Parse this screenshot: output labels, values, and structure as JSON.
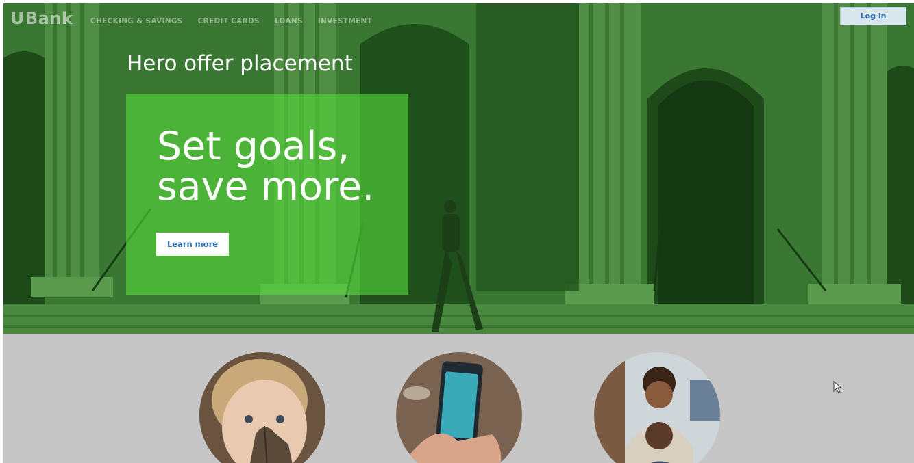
{
  "brand": {
    "logo_text": "Bank",
    "logo_mark": "U"
  },
  "nav": {
    "items": [
      {
        "label": "CHECKING & SAVINGS"
      },
      {
        "label": "CREDIT CARDS"
      },
      {
        "label": "LOANS"
      },
      {
        "label": "INVESTMENT"
      }
    ]
  },
  "header": {
    "login_label": "Log in"
  },
  "hero": {
    "placement_label": "Hero offer placement",
    "offer_title_line1": "Set goals,",
    "offer_title_line2": "save more.",
    "cta_label": "Learn more"
  },
  "colors": {
    "hero_overlay": "#2f6e28",
    "offer_box": "#56d93c",
    "link_blue": "#2f6fb0",
    "lower_bg": "#c6c6c6"
  },
  "feature_images": [
    {
      "name": "child-with-leaf-image"
    },
    {
      "name": "phone-in-hand-image"
    },
    {
      "name": "smiling-couple-image"
    }
  ]
}
